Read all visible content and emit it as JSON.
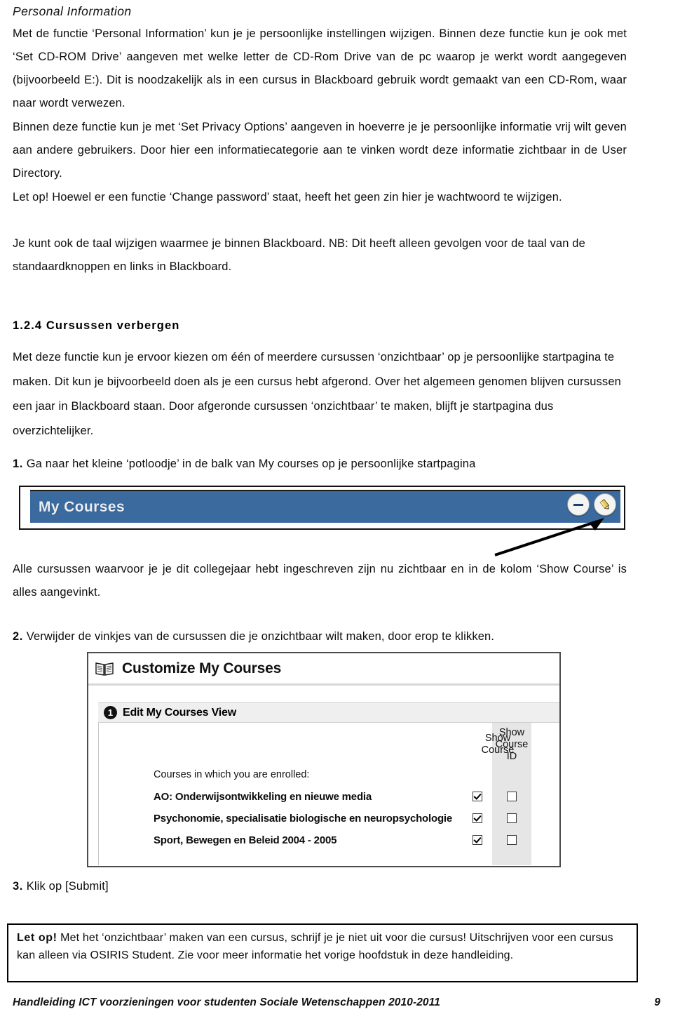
{
  "document": {
    "title": "Personal Information",
    "paragraphs": [
      "Met de functie ‘Personal Information’ kun je je persoonlijke instellingen wijzigen. Binnen deze functie kun je ook met ‘Set CD-ROM Drive’ aangeven met welke letter de CD-Rom Drive van de pc waarop je werkt wordt aangegeven (bijvoorbeeld E:). Dit is noodzakelijk als in een cursus in Blackboard gebruik wordt gemaakt van een CD-Rom, waar naar wordt verwezen.",
      "Binnen deze functie kun je met ‘Set Privacy Options’ aangeven in hoeverre je je persoonlijke informatie vrij wilt geven aan andere gebruikers. Door hier een informatiecategorie aan te vinken wordt deze informatie zichtbaar in de User Directory.",
      "Let op! Hoewel er een functie ‘Change password’ staat, heeft het geen zin hier je wachtwoord te wijzigen.",
      "Je kunt ook de taal wijzigen waarmee je binnen Blackboard. NB: Dit heeft alleen gevolgen voor de taal van de standaardknoppen en links in Blackboard."
    ],
    "section": {
      "heading": "1.2.4 Cursussen verbergen",
      "intro": "Met deze functie kun je ervoor kiezen om één of meerdere cursussen ‘onzichtbaar’ op je persoonlijke startpagina te maken. Dit kun je bijvoorbeeld doen als je een cursus hebt afgerond. Over het algemeen genomen blijven cursussen een jaar in Blackboard staan. Door afgeronde cursussen ‘onzichtbaar’ te maken, blijft je startpagina dus overzichtelijker."
    },
    "steps": [
      {
        "number": "1.",
        "text": "Ga naar het kleine ‘potloodje’ in de balk van My courses op je persoonlijke startpagina"
      },
      {
        "number": "2.",
        "text": "Verwijder de vinkjes van de cursussen die je onzichtbaar wilt maken, door erop te klikken."
      },
      {
        "number": "3.",
        "text": "Klik op [Submit]"
      }
    ],
    "after_first_shot": "Alle cursussen waarvoor je je dit collegejaar hebt ingeschreven zijn nu zichtbaar en in de kolom ‘Show Course’ is alles aangevinkt.",
    "warning": {
      "label": "Let op!",
      "text": " Met het ‘onzichtbaar’ maken van een cursus, schrijf je je niet uit voor die cursus! Uitschrijven voor een cursus kan alleen via OSIRIS Student. Zie voor meer informatie  het vorige hoofdstuk in deze handleiding."
    },
    "footer": {
      "left": "Handleiding ICT voorzieningen voor studenten Sociale Wetenschappen 2010-2011",
      "page": "9"
    }
  },
  "screenshot_mycourses": {
    "title": "My Courses",
    "bar_color": "#3a6a9e",
    "icons": [
      {
        "name": "minimize-icon",
        "glyph": "—"
      },
      {
        "name": "pencil-edit-icon",
        "glyph": "✎"
      }
    ]
  },
  "screenshot_customize": {
    "window_title": "Customize My Courses",
    "book_icon": "book-icon",
    "step": {
      "number": "1",
      "title": "Edit My Courses View"
    },
    "columns": [
      "Show Course",
      "Show Course ID"
    ],
    "enrolled_label": "Courses in which you are enrolled:",
    "rows": [
      {
        "name": "AO: Onderwijsontwikkeling en nieuwe media",
        "show_course": true,
        "show_course_id": false
      },
      {
        "name": "Psychonomie, specialisatie biologische en neuropsychologie",
        "show_course": true,
        "show_course_id": false
      },
      {
        "name": "Sport, Bewegen en Beleid 2004 - 2005",
        "show_course": true,
        "show_course_id": false
      }
    ]
  }
}
